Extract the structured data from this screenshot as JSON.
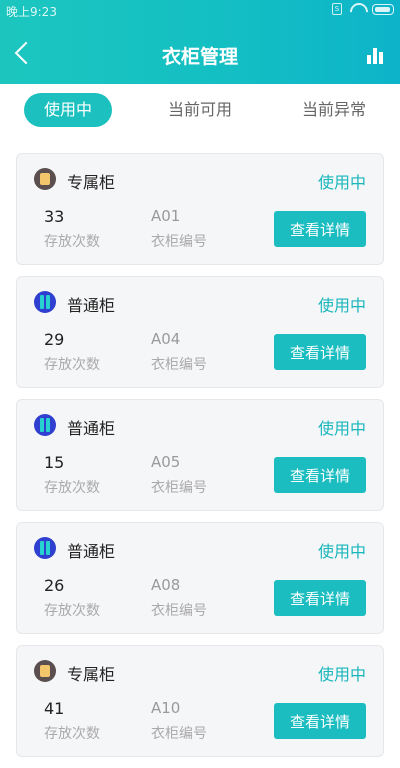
{
  "status_bar": {
    "time": "晚上9:23",
    "sim_label": "S"
  },
  "header": {
    "title": "衣柜管理",
    "back_icon": "chevron-left-icon",
    "stats_icon": "bar-chart-icon"
  },
  "tabs": [
    {
      "label": "使用中",
      "active": true
    },
    {
      "label": "当前可用",
      "active": false
    },
    {
      "label": "当前异常",
      "active": false
    }
  ],
  "colors": {
    "accent": "#1cc1bf",
    "status_text": "#19b7bc"
  },
  "cabinets": [
    {
      "type": "专属柜",
      "icon": "exclusive-cabinet-icon",
      "status": "使用中",
      "count": "33",
      "count_label": "存放次数",
      "code": "A01",
      "code_label": "衣柜编号",
      "button": "查看详情"
    },
    {
      "type": "普通柜",
      "icon": "normal-cabinet-icon",
      "status": "使用中",
      "count": "29",
      "count_label": "存放次数",
      "code": "A04",
      "code_label": "衣柜编号",
      "button": "查看详情"
    },
    {
      "type": "普通柜",
      "icon": "normal-cabinet-icon",
      "status": "使用中",
      "count": "15",
      "count_label": "存放次数",
      "code": "A05",
      "code_label": "衣柜编号",
      "button": "查看详情"
    },
    {
      "type": "普通柜",
      "icon": "normal-cabinet-icon",
      "status": "使用中",
      "count": "26",
      "count_label": "存放次数",
      "code": "A08",
      "code_label": "衣柜编号",
      "button": "查看详情"
    },
    {
      "type": "专属柜",
      "icon": "exclusive-cabinet-icon",
      "status": "使用中",
      "count": "41",
      "count_label": "存放次数",
      "code": "A10",
      "code_label": "衣柜编号",
      "button": "查看详情"
    }
  ]
}
